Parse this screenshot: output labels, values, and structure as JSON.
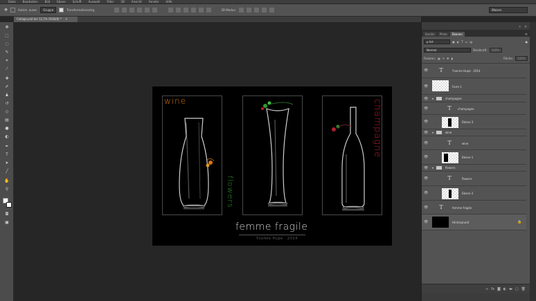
{
  "menubar": {
    "items": [
      "Datei",
      "Bearbeiten",
      "Bild",
      "Ebene",
      "Schrift",
      "Auswahl",
      "Filter",
      "3D",
      "Ansicht",
      "Fenster",
      "Hilfe"
    ]
  },
  "options": {
    "auto_select_label": "Autom. ausw.:",
    "auto_select_value": "Gruppe",
    "transform_label": "Transformationsstrg.",
    "mode_3d_label": "3D-Modus:",
    "workspace_value": "Wasser"
  },
  "document": {
    "tab_title": "Collage.psd bei 12,5% (RGB/8) *",
    "close_glyph": "×"
  },
  "artwork": {
    "word_wine": "wine",
    "word_flowers": "flowers",
    "word_champagne": "champagne",
    "title": "femme fragile",
    "subtitle": "Yvonne Hupe · 2014",
    "colors": {
      "wine": "#d8770f",
      "flowers": "#2f9a2f",
      "champagne": "#b01f2f"
    }
  },
  "panel": {
    "tabs": [
      {
        "label": "Kanäle"
      },
      {
        "label": "Pfade"
      },
      {
        "label": "Ebenen"
      }
    ],
    "kind_label": "ρ Art",
    "blend_mode": "Normal",
    "opacity_label": "Deckkraft:",
    "opacity_value": "100%",
    "lock_label": "Fixieren:",
    "fill_label": "Fläche:",
    "fill_value": "100%"
  },
  "layers": [
    {
      "name": "Yvonne Hupe · 2014",
      "kind": "text",
      "indent": 0
    },
    {
      "name": "Form 1",
      "kind": "shape",
      "indent": 0
    },
    {
      "name": "champagne",
      "kind": "group",
      "indent": 0
    },
    {
      "name": "champagne",
      "kind": "text",
      "indent": 1
    },
    {
      "name": "Ebene 3",
      "kind": "image",
      "indent": 1
    },
    {
      "name": "wine",
      "kind": "group",
      "indent": 0
    },
    {
      "name": "wine",
      "kind": "text",
      "indent": 1
    },
    {
      "name": "Ebene 1",
      "kind": "image",
      "indent": 1
    },
    {
      "name": "flowers",
      "kind": "group",
      "indent": 0
    },
    {
      "name": "flowers",
      "kind": "text",
      "indent": 1
    },
    {
      "name": "Ebene 2",
      "kind": "image",
      "indent": 1
    },
    {
      "name": "femme fragile",
      "kind": "text",
      "indent": 0
    },
    {
      "name": "Hintergrund",
      "kind": "background",
      "indent": 0
    }
  ],
  "icons": {
    "eye": "eye-icon",
    "lock": "lock-icon",
    "folder": "folder-icon",
    "text": "text-layer-icon"
  }
}
